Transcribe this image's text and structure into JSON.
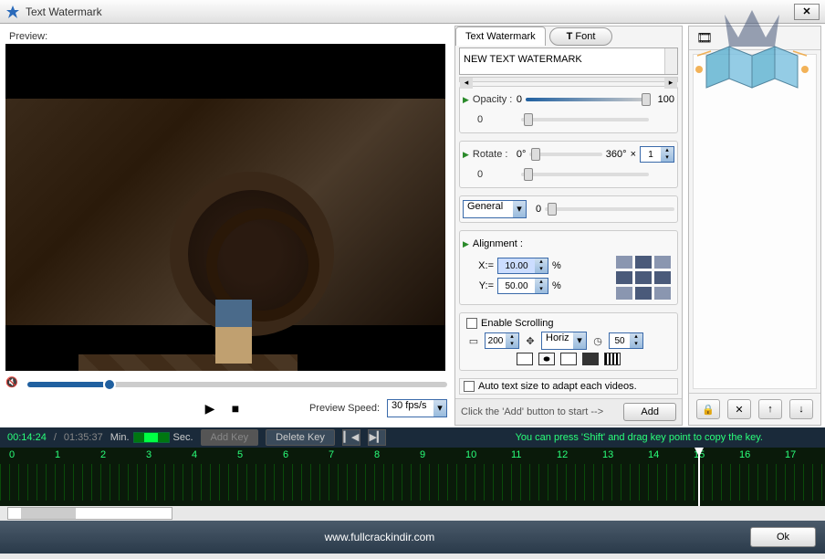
{
  "window": {
    "title": "Text Watermark",
    "close": "✕"
  },
  "preview": {
    "label": "Preview:"
  },
  "transport": {
    "play": "▶",
    "stop": "■",
    "speed_label": "Preview Speed:",
    "speed_value": "30 fps/s"
  },
  "tabs": {
    "main": "Text Watermark",
    "font": "T Font"
  },
  "watermark_text": "NEW TEXT WATERMARK",
  "opacity": {
    "label": "Opacity :",
    "min": "0",
    "max": "100",
    "key": "0"
  },
  "rotate": {
    "label": "Rotate  :",
    "min": "0°",
    "max": "360°",
    "mult": "×",
    "value": "1",
    "key": "0"
  },
  "mode": {
    "value": "General",
    "key": "0"
  },
  "alignment": {
    "label": "Alignment :",
    "x_label": "X:=",
    "x_value": "10.00",
    "y_label": "Y:=",
    "y_value": "50.00",
    "pct": "%"
  },
  "scrolling": {
    "enable": "Enable Scrolling",
    "width": "200",
    "dir_label": "Horiz",
    "speed": "50"
  },
  "autosize": "Auto text size to adapt each videos.",
  "hint": "Click the 'Add' button to start -->",
  "add": "Add",
  "timeline": {
    "current": "00:14:24",
    "total": "01:35:37",
    "slash": "/",
    "min": "Min.",
    "sec": "Sec.",
    "add_key": "Add Key",
    "delete_key": "Delete Key",
    "prev": "▎◀",
    "next": "▶▎",
    "hint": "You can press 'Shift' and drag key point to copy the key.",
    "marks": [
      "0",
      "1",
      "2",
      "3",
      "4",
      "5",
      "6",
      "7",
      "8",
      "9",
      "10",
      "11",
      "12",
      "13",
      "14",
      "15",
      "16",
      "17"
    ]
  },
  "footer": {
    "url": "www.fullcrackindir.com",
    "ok": "Ok"
  },
  "icons": {
    "lock": "🔒",
    "x": "✕",
    "up": "↑",
    "down": "↓",
    "film": "🎞",
    "mute": "🔇",
    "ruler": "▭",
    "move": "✥",
    "clock": "◷"
  }
}
